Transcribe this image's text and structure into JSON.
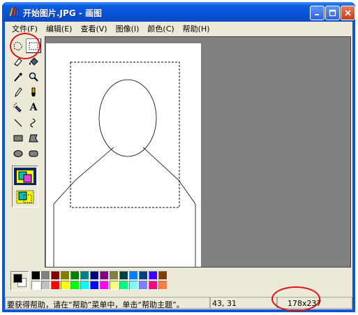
{
  "window": {
    "title": "开始图片.JPG - 画图",
    "icon": "paint-app-icon"
  },
  "menubar": {
    "items": [
      {
        "label": "文件(F)"
      },
      {
        "label": "编辑(E)"
      },
      {
        "label": "查看(V)"
      },
      {
        "label": "图像(I)"
      },
      {
        "label": "颜色(C)"
      },
      {
        "label": "帮助(H)"
      }
    ]
  },
  "toolbox": {
    "tools": [
      {
        "name": "free-form-select-tool"
      },
      {
        "name": "rectangle-select-tool",
        "selected": true
      },
      {
        "name": "eraser-tool"
      },
      {
        "name": "fill-tool"
      },
      {
        "name": "pick-color-tool"
      },
      {
        "name": "magnifier-tool"
      },
      {
        "name": "pencil-tool"
      },
      {
        "name": "brush-tool"
      },
      {
        "name": "airbrush-tool"
      },
      {
        "name": "text-tool",
        "glyph": "A"
      },
      {
        "name": "line-tool"
      },
      {
        "name": "curve-tool"
      },
      {
        "name": "rectangle-tool"
      },
      {
        "name": "polygon-tool"
      },
      {
        "name": "ellipse-tool"
      },
      {
        "name": "rounded-rectangle-tool"
      }
    ],
    "options": [
      "opaque-selection-option",
      "transparent-selection-option"
    ]
  },
  "palette": {
    "foreground": "#000000",
    "background": "#ffffff",
    "row1": [
      "#000000",
      "#808080",
      "#800000",
      "#808000",
      "#008000",
      "#008080",
      "#000080",
      "#800080",
      "#808040",
      "#004040",
      "#0080ff",
      "#004080",
      "#4000ff",
      "#804000"
    ],
    "row2": [
      "#ffffff",
      "#c0c0c0",
      "#ff0000",
      "#ffff00",
      "#00ff00",
      "#00ffff",
      "#0000ff",
      "#ff00ff",
      "#ffff80",
      "#00ff80",
      "#80ffff",
      "#8080ff",
      "#ff0080",
      "#ff8040"
    ]
  },
  "statusbar": {
    "help_text": "要获得帮助，请在“帮助”菜单中，单击“帮助主题”。",
    "cursor_pos": "43, 31",
    "selection_size": "178x237"
  }
}
